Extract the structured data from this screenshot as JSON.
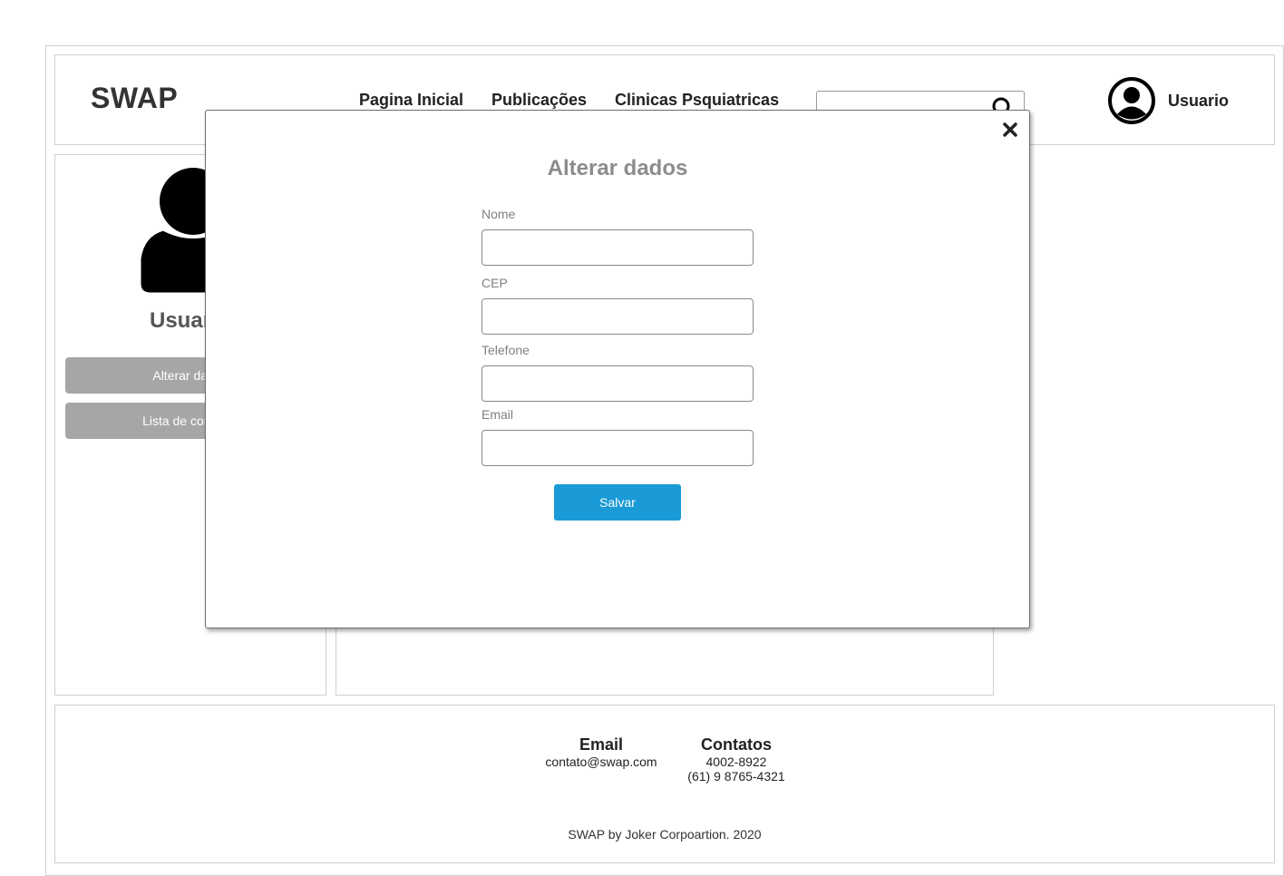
{
  "header": {
    "logo": "SWAP",
    "nav": [
      {
        "label": "Pagina Inicial"
      },
      {
        "label": "Publicações"
      },
      {
        "label": "Clinicas Psquiatricas"
      }
    ],
    "search": {
      "value": "",
      "icon": "search-icon"
    },
    "user": {
      "avatar_icon": "user-circle-icon",
      "label": "Usuario"
    }
  },
  "profile": {
    "avatar_icon": "user-silhouette-icon",
    "name": "Usuario",
    "buttons": [
      {
        "label": "Alterar dados"
      },
      {
        "label": "Lista de contatos"
      }
    ]
  },
  "modal": {
    "title": "Alterar dados",
    "close_icon": "close-icon",
    "fields": [
      {
        "label": "Nome",
        "value": "",
        "placeholder": ""
      },
      {
        "label": "CEP",
        "value": "",
        "placeholder": ""
      },
      {
        "label": "Telefone",
        "value": "",
        "placeholder": ""
      },
      {
        "label": "Email",
        "value": "",
        "placeholder": ""
      }
    ],
    "save_label": "Salvar",
    "save_color": "#1a9ad6"
  },
  "footer": {
    "email": {
      "heading": "Email",
      "value": "contato@swap.com"
    },
    "contacts": {
      "heading": "Contatos",
      "phone1": "4002-8922",
      "phone2": "(61) 9 8765-4321"
    },
    "copyright": "SWAP by Joker Corpoartion. 2020"
  }
}
